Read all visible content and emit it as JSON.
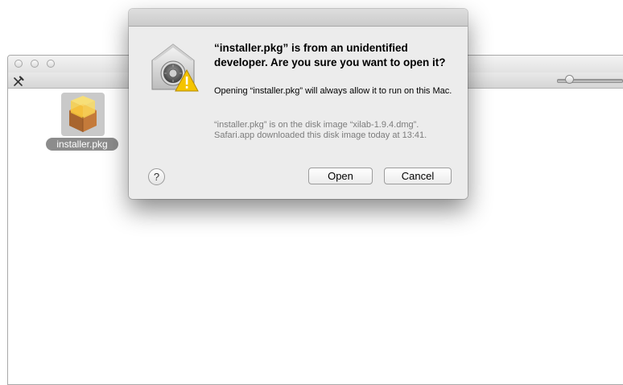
{
  "finder": {
    "file": {
      "name": "installer.pkg",
      "icon": "package-icon"
    },
    "toolbar": {
      "tool_icon": "tools-icon",
      "zoom_slider_icon": "icon-size-slider"
    }
  },
  "dialog": {
    "icon": "gatekeeper-lock-warning-icon",
    "title": "“installer.pkg” is from an unidentified developer. Are you sure you want to open it?",
    "message": "Opening “installer.pkg” will always allow it to run on this Mac.",
    "info": "“installer.pkg” is on the disk image “xilab-1.9.4.dmg”. Safari.app downloaded this disk image today at 13:41.",
    "help_label": "?",
    "open_label": "Open",
    "cancel_label": "Cancel"
  },
  "colors": {
    "dialog_bg": "#ececec",
    "label_highlight": "#8c8c8c",
    "warning_yellow": "#f5c400"
  }
}
